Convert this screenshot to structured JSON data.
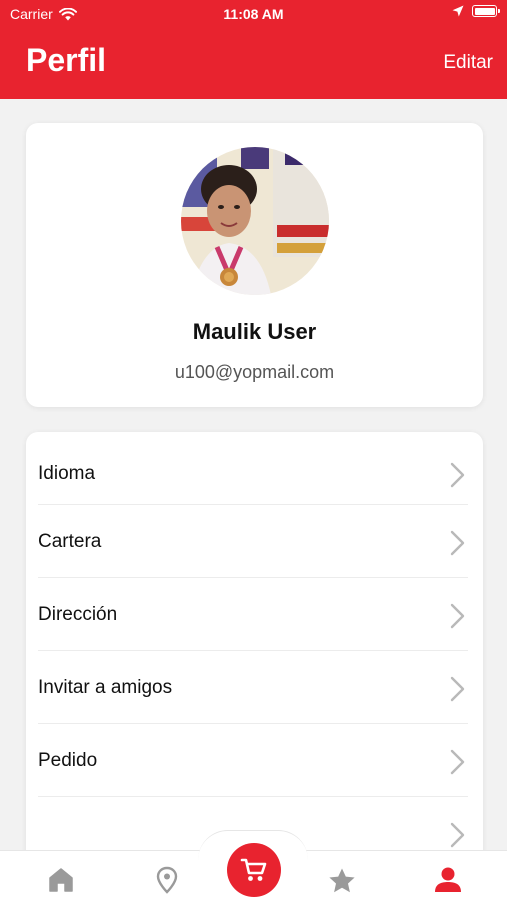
{
  "status_bar": {
    "carrier": "Carrier",
    "time": "11:08 AM"
  },
  "nav": {
    "title": "Perfil",
    "edit_label": "Editar"
  },
  "profile": {
    "name": "Maulik User",
    "email": "u100@yopmail.com"
  },
  "menu": [
    {
      "label": "Idioma"
    },
    {
      "label": "Cartera"
    },
    {
      "label": "Dirección"
    },
    {
      "label": "Invitar a amigos"
    },
    {
      "label": "Pedido"
    }
  ],
  "tabs": [
    {
      "name": "home",
      "icon": "home-icon"
    },
    {
      "name": "location",
      "icon": "location-pin-icon"
    },
    {
      "name": "cart",
      "icon": "cart-icon"
    },
    {
      "name": "favorites",
      "icon": "star-icon"
    },
    {
      "name": "profile",
      "icon": "user-icon",
      "active": true
    }
  ],
  "colors": {
    "brand": "#e8232f",
    "inactive_icon": "#9a9a9a",
    "background": "#f2f2f2"
  }
}
